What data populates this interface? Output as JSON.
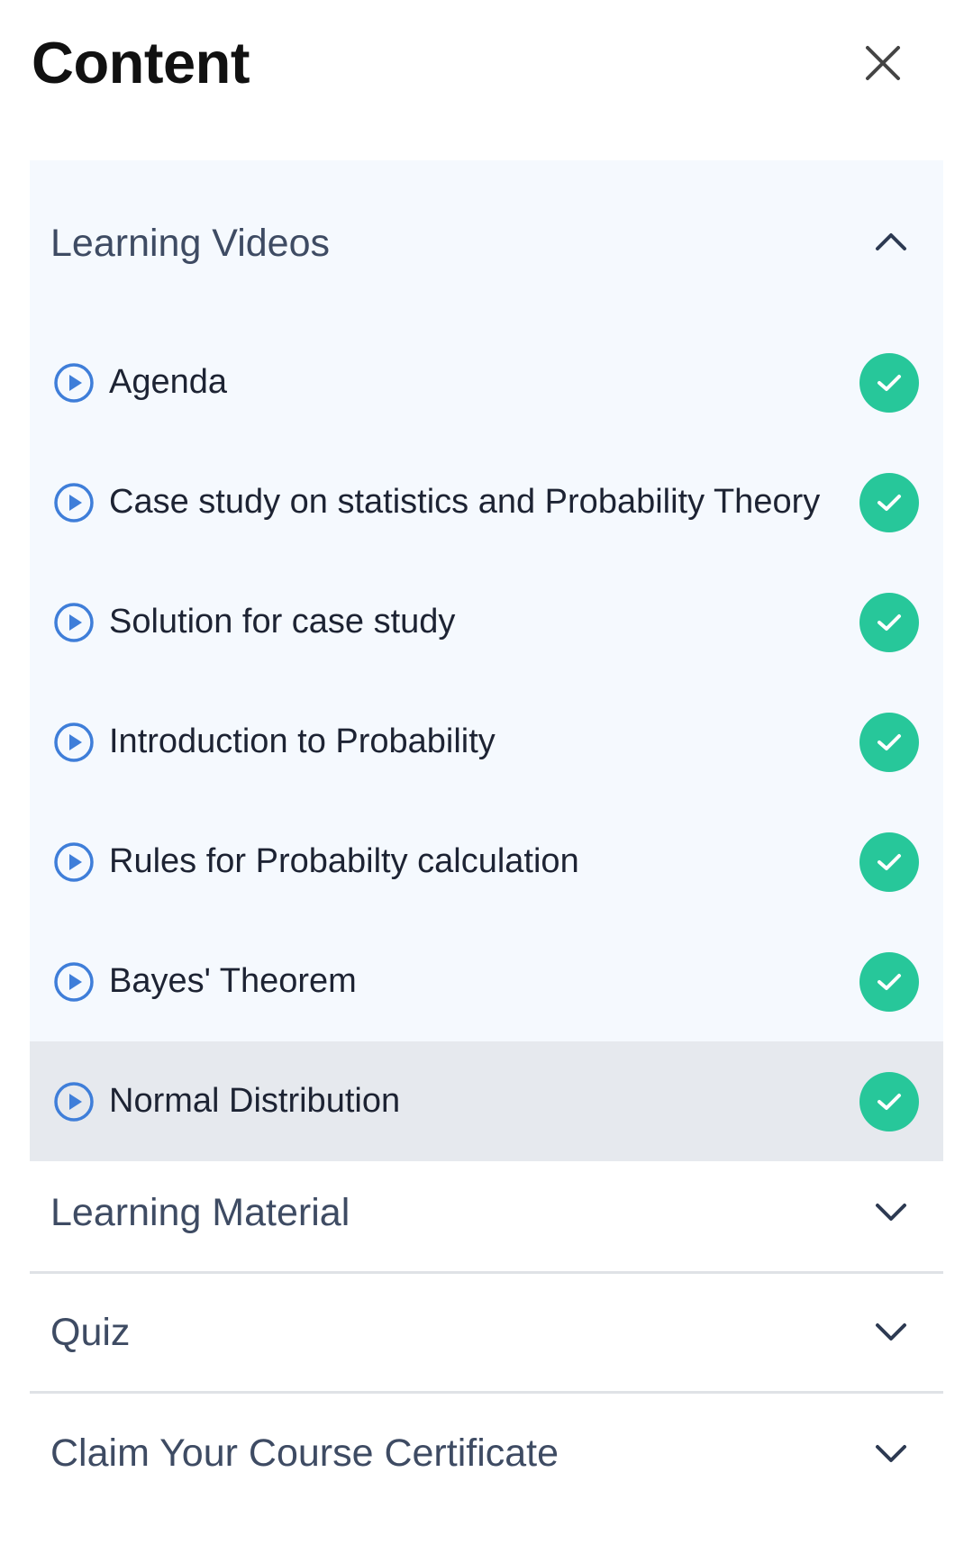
{
  "header": {
    "title": "Content",
    "close_icon": "close-icon"
  },
  "sections": {
    "learning_videos": {
      "title": "Learning Videos",
      "expanded": true,
      "items": [
        {
          "label": "Agenda",
          "completed": true
        },
        {
          "label": "Case study on statistics and Probability Theory",
          "completed": true
        },
        {
          "label": "Solution for case study",
          "completed": true
        },
        {
          "label": "Introduction to Probability",
          "completed": true
        },
        {
          "label": "Rules for Probabilty calculation",
          "completed": true
        },
        {
          "label": "Bayes' Theorem",
          "completed": true
        },
        {
          "label": "Normal Distribution",
          "completed": true,
          "active": true
        }
      ]
    },
    "learning_material": {
      "title": "Learning Material",
      "expanded": false
    },
    "quiz": {
      "title": "Quiz",
      "expanded": false
    },
    "certificate": {
      "title": "Claim Your Course Certificate",
      "expanded": false
    }
  },
  "colors": {
    "accent_blue": "#3f7ed9",
    "success_green": "#27c79a",
    "section_title": "#3e4b63",
    "panel_bg": "#f5f9fe",
    "active_bg": "#e6e9ee"
  }
}
